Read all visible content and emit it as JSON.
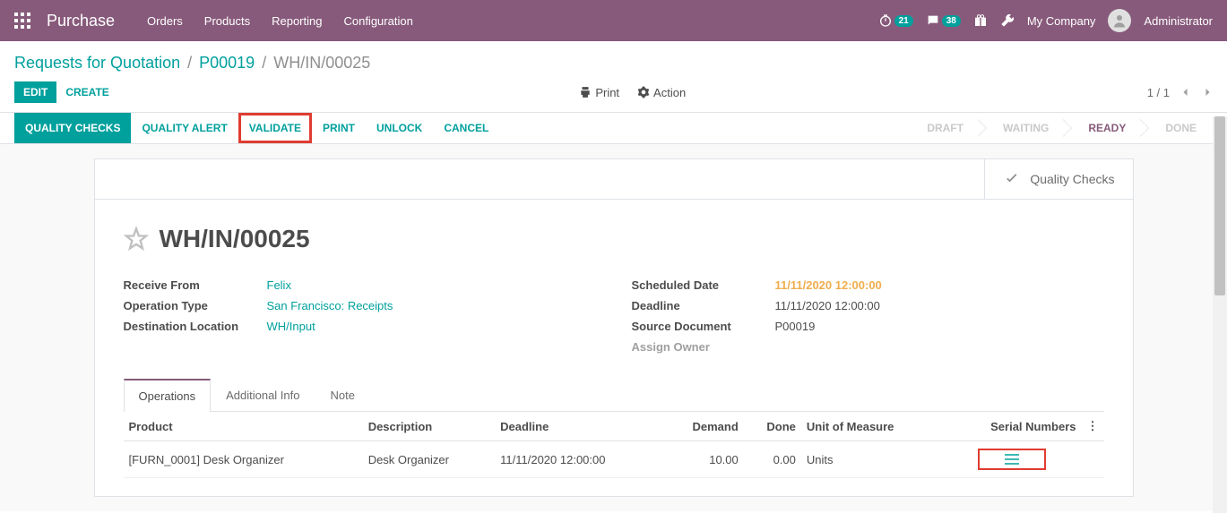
{
  "nav": {
    "app": "Purchase",
    "items": [
      "Orders",
      "Products",
      "Reporting",
      "Configuration"
    ],
    "timer_badge": "21",
    "chat_badge": "38",
    "company": "My Company",
    "user": "Administrator"
  },
  "breadcrumb": {
    "items": [
      "Requests for Quotation",
      "P00019"
    ],
    "current": "WH/IN/00025"
  },
  "controls": {
    "edit": "Edit",
    "create": "Create",
    "print": "Print",
    "action": "Action",
    "pager": "1 / 1"
  },
  "actionbar": {
    "quality_checks": "Quality Checks",
    "quality_alert": "Quality Alert",
    "validate": "Validate",
    "print": "Print",
    "unlock": "Unlock",
    "cancel": "Cancel"
  },
  "status": {
    "steps": [
      "Draft",
      "Waiting",
      "Ready",
      "Done"
    ],
    "active": "Ready"
  },
  "stat_buttons": {
    "quality_checks": "Quality Checks"
  },
  "record": {
    "name": "WH/IN/00025",
    "left": {
      "receive_from_label": "Receive From",
      "receive_from": "Felix",
      "op_type_label": "Operation Type",
      "op_type": "San Francisco: Receipts",
      "dest_label": "Destination Location",
      "dest": "WH/Input"
    },
    "right": {
      "sched_label": "Scheduled Date",
      "sched": "11/11/2020 12:00:00",
      "deadline_label": "Deadline",
      "deadline": "11/11/2020 12:00:00",
      "src_label": "Source Document",
      "src": "P00019",
      "owner_label": "Assign Owner"
    }
  },
  "tabs": {
    "items": [
      "Operations",
      "Additional Info",
      "Note"
    ],
    "active": "Operations"
  },
  "table": {
    "headers": {
      "product": "Product",
      "desc": "Description",
      "deadline": "Deadline",
      "demand": "Demand",
      "done": "Done",
      "uom": "Unit of Measure",
      "serial": "Serial Numbers"
    },
    "rows": [
      {
        "product": "[FURN_0001] Desk Organizer",
        "desc": "Desk Organizer",
        "deadline": "11/11/2020 12:00:00",
        "demand": "10.00",
        "done": "0.00",
        "uom": "Units"
      }
    ]
  }
}
